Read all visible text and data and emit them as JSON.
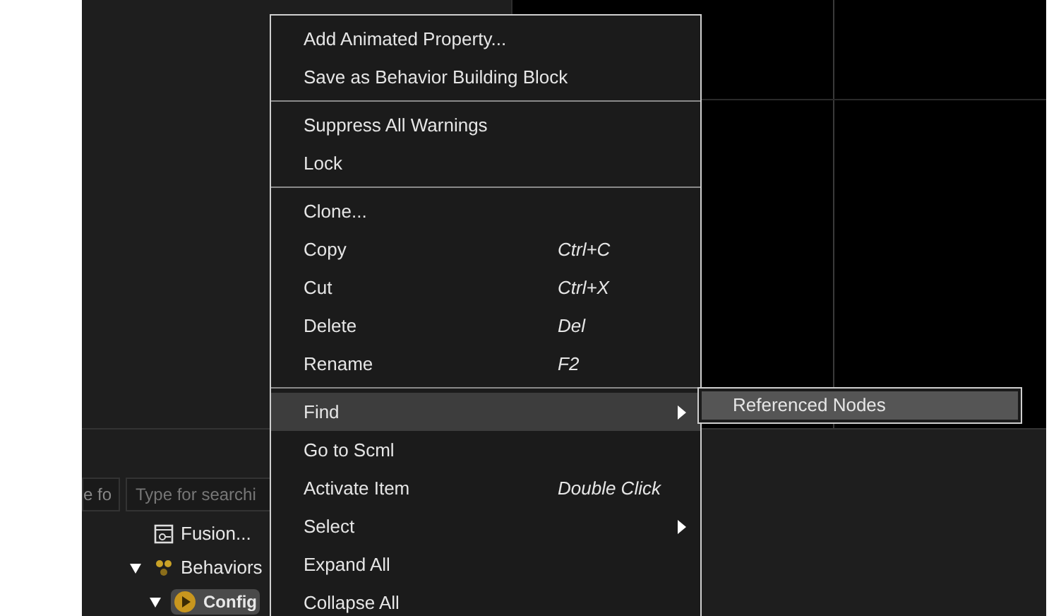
{
  "panel": {
    "filter_field": {
      "value": "e fo"
    },
    "search_field": {
      "placeholder": "Type for searchi"
    },
    "tree": [
      {
        "label": "Fusion...",
        "kind": "document"
      },
      {
        "label": "Behaviors",
        "kind": "behaviors",
        "expanded": true,
        "children": [
          {
            "label": "Config",
            "kind": "animation",
            "expanded": true,
            "selected": true
          }
        ]
      }
    ]
  },
  "context_menu": {
    "sections": [
      [
        {
          "label": "Add Animated Property...",
          "selected": false
        },
        {
          "label": "Save as Behavior Building Block",
          "selected": false
        }
      ],
      [
        {
          "label": "Suppress All Warnings",
          "selected": false
        },
        {
          "label": "Lock",
          "selected": false
        }
      ],
      [
        {
          "label": "Clone...",
          "selected": false
        },
        {
          "label": "Copy",
          "shortcut": "Ctrl+C",
          "selected": false
        },
        {
          "label": "Cut",
          "shortcut": "Ctrl+X",
          "selected": false
        },
        {
          "label": "Delete",
          "shortcut": "Del",
          "selected": false
        },
        {
          "label": "Rename",
          "shortcut": "F2",
          "selected": false
        }
      ],
      [
        {
          "label": "Find",
          "submenu": true,
          "selected": true
        },
        {
          "label": "Go to Scml",
          "selected": false
        },
        {
          "label": "Activate Item",
          "shortcut": "Double Click",
          "selected": false
        },
        {
          "label": "Select",
          "submenu": true,
          "selected": false
        },
        {
          "label": "Expand All",
          "selected": false
        },
        {
          "label": "Collapse All",
          "selected": false
        }
      ]
    ]
  },
  "submenu": {
    "items": [
      {
        "label": "Referenced Nodes",
        "selected": true
      }
    ]
  }
}
